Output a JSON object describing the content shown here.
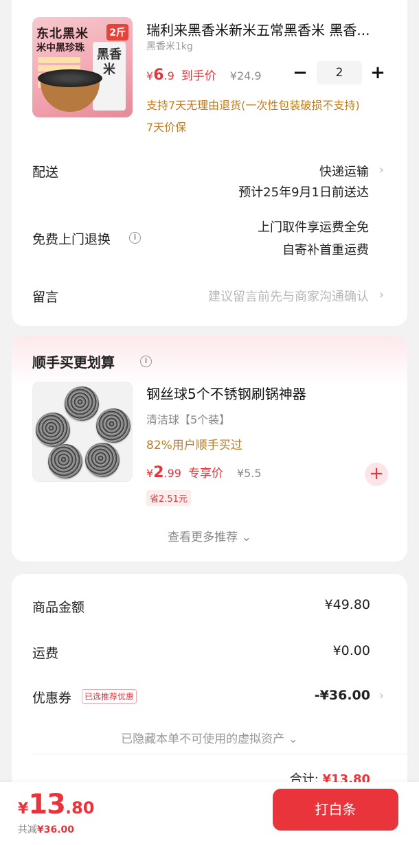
{
  "product": {
    "title": "瑞利来黑香米新米五常黑香米 黑香...",
    "spec": "黑香米1kg",
    "image": {
      "line1": "东北黑米",
      "line2": "米中黑珍珠",
      "badge": "2斤",
      "bag_text": "黑香米"
    },
    "price_symbol": "¥",
    "price_int": "6",
    "price_dec": ".9",
    "price_label": "到手价",
    "original_price": "¥24.9",
    "quantity": "2",
    "return_notice": "支持7天无理由退货(一次性包装破损不支持)",
    "price_protect": "7天价保"
  },
  "delivery": {
    "label": "配送",
    "method": "快递运输",
    "eta": "预计25年9月1日前送达"
  },
  "return_service": {
    "label": "免费上门退换",
    "line1": "上门取件享运费全免",
    "line2": "自寄补首重运费"
  },
  "message": {
    "label": "留言",
    "placeholder": "建议留言前先与商家沟通确认"
  },
  "recommend": {
    "section_title": "顺手买更划算",
    "item_title": "钢丝球5个不锈钢刷锅神器",
    "item_spec": "清洁球【5个装】",
    "item_stat": "82%用户顺手买过",
    "price_symbol": "¥",
    "price_int": "2",
    "price_dec": ".99",
    "price_label": "专享价",
    "original_price": "¥5.5",
    "save": "省2.51元",
    "more": "查看更多推荐 ⌄"
  },
  "summary": {
    "goods_label": "商品金额",
    "goods_value": "¥49.80",
    "shipping_label": "运费",
    "shipping_value": "¥0.00",
    "coupon_label": "优惠券",
    "coupon_tag": "已选推荐优惠",
    "coupon_value": "-¥36.00",
    "hidden_assets": "已隐藏本单不可使用的虚拟资产 ⌄",
    "total_label": "合计:",
    "total_value": "¥13.80"
  },
  "bottom": {
    "price_symbol": "¥",
    "price_int": "13",
    "price_dec": ".80",
    "save_label": "共减",
    "save_value": "¥36.00",
    "pay_button": "打白条"
  },
  "colors": {
    "accent": "#e8343a",
    "notice": "#c17c1c"
  }
}
